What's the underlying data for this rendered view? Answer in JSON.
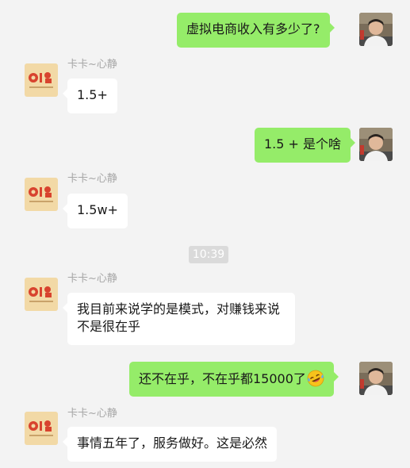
{
  "contact": {
    "name": "卡卡~心静"
  },
  "messages": [
    {
      "side": "right",
      "text": "虚拟电商收入有多少了?"
    },
    {
      "side": "left",
      "text": "1.5+"
    },
    {
      "side": "right",
      "text": "1.5 + 是个啥"
    },
    {
      "side": "left",
      "text": "1.5w+"
    },
    {
      "type": "timestamp",
      "text": "10:39"
    },
    {
      "side": "left",
      "text": "我目前来说学的是模式，对赚钱来说不是很在乎"
    },
    {
      "side": "right",
      "text": "还不在乎，不在乎都15000了",
      "emoji": "rolling-laughing-emoji"
    },
    {
      "side": "left",
      "text": "事情五年了，服务做好。这是必然"
    }
  ],
  "colors": {
    "background": "#f3f3f3",
    "bubble_sent": "#95ec69",
    "bubble_received": "#ffffff",
    "sender_name": "#a6a6a6",
    "timestamp_bg": "#dadada"
  }
}
